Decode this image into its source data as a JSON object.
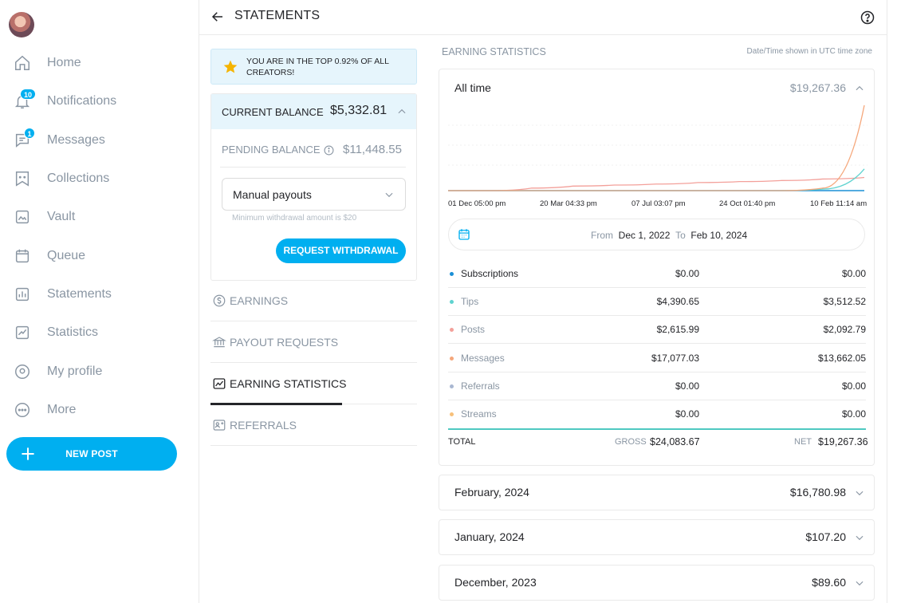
{
  "colors": {
    "accent": "#00aff0",
    "subscriptions": "#1a8fd6",
    "tips": "#5fd3d0",
    "posts": "#f3a09a",
    "messages": "#f5a77b",
    "referrals": "#a9b7d1",
    "streams": "#f7c07a"
  },
  "sidebar": {
    "items": [
      {
        "label": "Home",
        "icon": "home-icon"
      },
      {
        "label": "Notifications",
        "icon": "bell-icon",
        "badge": "10"
      },
      {
        "label": "Messages",
        "icon": "message-icon",
        "badge": "1"
      },
      {
        "label": "Collections",
        "icon": "collections-icon"
      },
      {
        "label": "Vault",
        "icon": "vault-icon"
      },
      {
        "label": "Queue",
        "icon": "calendar-icon"
      },
      {
        "label": "Statements",
        "icon": "statements-icon"
      },
      {
        "label": "Statistics",
        "icon": "statistics-icon"
      },
      {
        "label": "My profile",
        "icon": "profile-icon"
      },
      {
        "label": "More",
        "icon": "more-icon"
      }
    ],
    "new_post_label": "NEW POST"
  },
  "header": {
    "title": "STATEMENTS"
  },
  "left": {
    "banner": "YOU ARE IN THE TOP 0.92% OF ALL CREATORS!",
    "current_balance_label": "CURRENT BALANCE",
    "current_balance_value": "$5,332.81",
    "pending_balance_label": "PENDING BALANCE",
    "pending_balance_value": "$11,448.55",
    "payout_select_value": "Manual payouts",
    "min_note": "Minimum withdrawal amount is $20",
    "withdraw_label": "REQUEST WITHDRAWAL",
    "tabs": [
      {
        "label": "EARNINGS",
        "icon": "dollar-circle-icon"
      },
      {
        "label": "PAYOUT REQUESTS",
        "icon": "bank-icon"
      },
      {
        "label": "EARNING STATISTICS",
        "icon": "chart-line-icon",
        "active": true
      },
      {
        "label": "REFERRALS",
        "icon": "referrals-icon"
      }
    ]
  },
  "stats": {
    "heading": "EARNING STATISTICS",
    "tz_note": "Date/Time shown in UTC time zone",
    "period_label": "All time",
    "period_value": "$19,267.36",
    "date_from_label": "From",
    "date_from": "Dec 1, 2022",
    "date_to_label": "To",
    "date_to": "Feb 10, 2024",
    "breakdown": [
      {
        "category": "Subscriptions",
        "gross": "$0.00",
        "net": "$0.00"
      },
      {
        "category": "Tips",
        "gross": "$4,390.65",
        "net": "$3,512.52"
      },
      {
        "category": "Posts",
        "gross": "$2,615.99",
        "net": "$2,092.79"
      },
      {
        "category": "Messages",
        "gross": "$17,077.03",
        "net": "$13,662.05"
      },
      {
        "category": "Referrals",
        "gross": "$0.00",
        "net": "$0.00"
      },
      {
        "category": "Streams",
        "gross": "$0.00",
        "net": "$0.00"
      }
    ],
    "total_label": "TOTAL",
    "gross_label": "GROSS",
    "gross_total": "$24,083.67",
    "net_label": "NET",
    "net_total": "$19,267.36"
  },
  "months": [
    {
      "label": "February, 2024",
      "value": "$16,780.98"
    },
    {
      "label": "January, 2024",
      "value": "$107.20"
    },
    {
      "label": "December, 2023",
      "value": "$89.60"
    }
  ],
  "chart_data": {
    "type": "line",
    "x_tick_labels": [
      "01 Dec 05:00 pm",
      "20 Mar 04:33 pm",
      "07 Jul 03:07 pm",
      "24 Oct 01:40 pm",
      "10 Feb 11:14 am"
    ],
    "grid": true,
    "legend": "none",
    "series_note": "approximate relative trends",
    "series": [
      {
        "color": "#1a8fd6",
        "values": [
          0,
          0,
          0,
          0,
          0,
          0,
          0,
          0,
          0,
          0,
          0
        ]
      },
      {
        "color": "#f3a09a",
        "values": [
          0,
          0,
          0.5,
          0.9,
          1.1,
          1.3,
          1.6,
          1.8,
          2.0,
          2.3,
          2.6
        ]
      },
      {
        "color": "#5fd3d0",
        "values": [
          0,
          0,
          0,
          0,
          0,
          0,
          0,
          0,
          0,
          0.3,
          4.3
        ]
      },
      {
        "color": "#f5a77b",
        "values": [
          0,
          0,
          0,
          0,
          0,
          0,
          0,
          0,
          0,
          0.5,
          16.9
        ]
      }
    ]
  }
}
